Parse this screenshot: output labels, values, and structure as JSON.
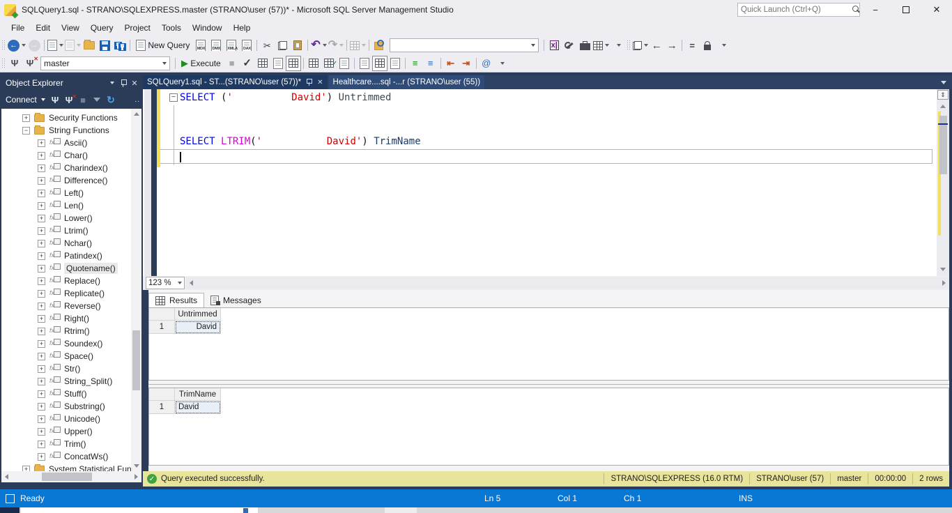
{
  "window": {
    "title": "SQLQuery1.sql - STRANO\\SQLEXPRESS.master (STRANO\\user (57))* - Microsoft SQL Server Management Studio",
    "quick_launch_placeholder": "Quick Launch (Ctrl+Q)"
  },
  "menu": {
    "items": [
      "File",
      "Edit",
      "View",
      "Query",
      "Project",
      "Tools",
      "Window",
      "Help"
    ]
  },
  "icons": {
    "back": "←",
    "forward": "→",
    "scissors": "✂",
    "undo": "↶",
    "redo": "↷",
    "check": "✓",
    "play": "▶",
    "stop": "■",
    "close": "✕",
    "minimize": "−",
    "plug": "Ψ",
    "refresh": "↻",
    "equals": "=",
    "at": "@",
    "fx": "fx",
    "comment": "≡",
    "outdent": "⇤",
    "indent": "⇥",
    "navback": "←",
    "navfwd": "→",
    "dots": ".."
  },
  "toolbar1": {
    "new_query_label": "New Query",
    "doc_buttons": [
      "MDX",
      "DMX",
      "XMLA",
      "DAX"
    ],
    "search_value": ""
  },
  "toolbar2": {
    "database": "master",
    "execute_label": "Execute"
  },
  "object_explorer": {
    "title": "Object Explorer",
    "connect_label": "Connect",
    "tree": [
      {
        "label": "Security Functions",
        "icon": "folder",
        "exp": "+",
        "level": 0
      },
      {
        "label": "String Functions",
        "icon": "folder",
        "exp": "-",
        "level": 0
      },
      {
        "label": "Ascii()",
        "icon": "fn",
        "exp": "+",
        "level": 1
      },
      {
        "label": "Char()",
        "icon": "fn",
        "exp": "+",
        "level": 1
      },
      {
        "label": "Charindex()",
        "icon": "fn",
        "exp": "+",
        "level": 1
      },
      {
        "label": "Difference()",
        "icon": "fn",
        "exp": "+",
        "level": 1
      },
      {
        "label": "Left()",
        "icon": "fn",
        "exp": "+",
        "level": 1
      },
      {
        "label": "Len()",
        "icon": "fn",
        "exp": "+",
        "level": 1
      },
      {
        "label": "Lower()",
        "icon": "fn",
        "exp": "+",
        "level": 1
      },
      {
        "label": "Ltrim()",
        "icon": "fn",
        "exp": "+",
        "level": 1
      },
      {
        "label": "Nchar()",
        "icon": "fn",
        "exp": "+",
        "level": 1
      },
      {
        "label": "Patindex()",
        "icon": "fn",
        "exp": "+",
        "level": 1
      },
      {
        "label": "Quotename()",
        "icon": "fn",
        "exp": "+",
        "level": 1,
        "selected": true
      },
      {
        "label": "Replace()",
        "icon": "fn",
        "exp": "+",
        "level": 1
      },
      {
        "label": "Replicate()",
        "icon": "fn",
        "exp": "+",
        "level": 1
      },
      {
        "label": "Reverse()",
        "icon": "fn",
        "exp": "+",
        "level": 1
      },
      {
        "label": "Right()",
        "icon": "fn",
        "exp": "+",
        "level": 1
      },
      {
        "label": "Rtrim()",
        "icon": "fn",
        "exp": "+",
        "level": 1
      },
      {
        "label": "Soundex()",
        "icon": "fn",
        "exp": "+",
        "level": 1
      },
      {
        "label": "Space()",
        "icon": "fn",
        "exp": "+",
        "level": 1
      },
      {
        "label": "Str()",
        "icon": "fn",
        "exp": "+",
        "level": 1
      },
      {
        "label": "String_Split()",
        "icon": "fn",
        "exp": "+",
        "level": 1
      },
      {
        "label": "Stuff()",
        "icon": "fn",
        "exp": "+",
        "level": 1
      },
      {
        "label": "Substring()",
        "icon": "fn",
        "exp": "+",
        "level": 1
      },
      {
        "label": "Unicode()",
        "icon": "fn",
        "exp": "+",
        "level": 1
      },
      {
        "label": "Upper()",
        "icon": "fn",
        "exp": "+",
        "level": 1
      },
      {
        "label": "Trim()",
        "icon": "fn",
        "exp": "+",
        "level": 1
      },
      {
        "label": "ConcatWs()",
        "icon": "fn",
        "exp": "+",
        "level": 1
      },
      {
        "label": "System Statistical Fun",
        "icon": "folder",
        "exp": "+",
        "level": 0
      }
    ]
  },
  "tabs": [
    {
      "label": "SQLQuery1.sql - ST...(STRANO\\user (57))*",
      "active": true
    },
    {
      "label": "Healthcare....sql -...r (STRANO\\user (55))",
      "active": false
    }
  ],
  "editor": {
    "zoom_level": "123 %",
    "lines": [
      {
        "collapse": true,
        "tokens": [
          {
            "c": "kw",
            "t": "SELECT"
          },
          {
            "c": "pl",
            "t": " ("
          },
          {
            "c": "str",
            "t": "'          David'"
          },
          {
            "c": "pl",
            "t": ") "
          },
          {
            "c": "id1",
            "t": "Untrimmed"
          }
        ]
      },
      {
        "tokens": []
      },
      {
        "tokens": []
      },
      {
        "tokens": [
          {
            "c": "kw",
            "t": "SELECT"
          },
          {
            "c": "pl",
            "t": " "
          },
          {
            "c": "fn",
            "t": "LTRIM"
          },
          {
            "c": "pl",
            "t": "("
          },
          {
            "c": "str",
            "t": "'           David'"
          },
          {
            "c": "pl",
            "t": ") "
          },
          {
            "c": "id2",
            "t": "TrimName"
          }
        ]
      },
      {
        "current": true,
        "tokens": []
      }
    ]
  },
  "results": {
    "tabs": [
      "Results",
      "Messages"
    ],
    "grids": [
      {
        "column": "Untrimmed",
        "align": "right",
        "rows": [
          {
            "num": "1",
            "value": "David"
          }
        ]
      },
      {
        "column": "TrimName",
        "align": "left",
        "rows": [
          {
            "num": "1",
            "value": "David"
          }
        ]
      }
    ]
  },
  "query_status": {
    "message": "Query executed successfully.",
    "segments": [
      "STRANO\\SQLEXPRESS (16.0 RTM)",
      "STRANO\\user (57)",
      "master",
      "00:00:00",
      "2 rows"
    ]
  },
  "status_bar": {
    "state": "Ready",
    "line": "Ln 5",
    "col": "Col 1",
    "ch": "Ch 1",
    "mode": "INS"
  }
}
